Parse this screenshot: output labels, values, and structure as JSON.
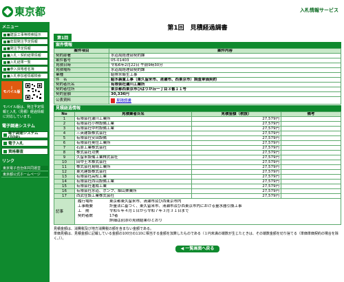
{
  "header": {
    "logo": "東京都",
    "right_link": "入札情報サービス"
  },
  "sidebar": {
    "menu_title": "メニュー",
    "items": [
      "■建設工事等検索提示",
      "■年間発注予定情報",
      "■発注予定情報",
      "■入札・契約結果情報",
      "■入札結果一覧",
      "■参入資格者名簿",
      "■入札参加者情報検索"
    ],
    "mobile_label": "モバイル版",
    "mobile_note": "モバイル版は、発注予定情報と入札（見積）経過情報に対応しています。",
    "system_title": "電子調達システム",
    "buttons": [
      "電子調達システム(TOP)",
      "電子入札",
      "資格審査"
    ],
    "links_title": "リンク",
    "links": [
      "東京電子自治体共同運営",
      "東京都公式ホームページ"
    ]
  },
  "main": {
    "title": "第1回　見積経過調書",
    "round_tab": "第1回",
    "info_bar": "案件情報",
    "info_header": {
      "item": "案件項目",
      "content": "案件内容"
    },
    "info_rows": [
      {
        "k": "契約部署",
        "v": "水道局経理部契約課"
      },
      {
        "k": "案件番号",
        "v": "05-01403"
      },
      {
        "k": "見積日時",
        "v": "令和6年2月22日 午前9時30分"
      },
      {
        "k": "見積場所",
        "v": "水道局経理部契約課"
      },
      {
        "k": "業種",
        "v": "給排水衛生工事"
      },
      {
        "k": "件　名",
        "v": "給水装置工事（東久留米市、清瀬市、西東京市）調査単価契約"
      },
      {
        "k": "契約者氏名",
        "v": "有限会社瀬川工業所"
      },
      {
        "k": "契約者住所",
        "v": "東京都西東京市ひばりが丘一丁目３番１１号"
      },
      {
        "k": "契約金額",
        "v": "30,336円"
      },
      {
        "k": "公表資料",
        "v": "見積調書"
      }
    ],
    "result_bar": "見積経過情報",
    "result_header": {
      "no": "No",
      "name": "見積業者氏名",
      "amount": "見積金額（税抜）",
      "remark": "備考"
    },
    "results": [
      {
        "no": "1",
        "name": "有限会社瀬川工業所",
        "amount": "27,579円"
      },
      {
        "no": "2",
        "name": "有限会社小林設備工業",
        "amount": "27,579円"
      },
      {
        "no": "3",
        "name": "有限会社中村設備工業",
        "amount": "27,579円"
      },
      {
        "no": "4",
        "name": "三英建設株式会社",
        "amount": "27,579円"
      },
      {
        "no": "5",
        "name": "有限会社安田設備",
        "amount": "27,579円"
      },
      {
        "no": "6",
        "name": "有限会社奥住工業所",
        "amount": "27,579円"
      },
      {
        "no": "7",
        "name": "石原工業株式会社",
        "amount": "27,579円"
      },
      {
        "no": "8",
        "name": "株式会社功美",
        "amount": "27,579円"
      },
      {
        "no": "9",
        "name": "久留米設備工業株式会社",
        "amount": "27,579円"
      },
      {
        "no": "10",
        "name": "田中土木株式会社",
        "amount": "27,579円"
      },
      {
        "no": "11",
        "name": "株式会社島崎工業所",
        "amount": "27,579円"
      },
      {
        "no": "12",
        "name": "東光建設株式会社",
        "amount": "27,579円"
      },
      {
        "no": "13",
        "name": "有限会社高松工業",
        "amount": "27,579円"
      },
      {
        "no": "14",
        "name": "有限会社西山設備工業",
        "amount": "27,579円"
      },
      {
        "no": "15",
        "name": "有限会社進成工業",
        "amount": "27,579円"
      },
      {
        "no": "16",
        "name": "有限会社水道、ポンプ、細山栗業所",
        "amount": "27,579円"
      },
      {
        "no": "17",
        "name": "西武住設工業株式会社",
        "amount": "27,579円"
      }
    ],
    "remarks_label": "記事",
    "remarks": [
      {
        "k": "履行場所",
        "v": "東京都東久留米市、清瀬市及び西東京市内"
      },
      {
        "k": "工事概要",
        "v": "計量法に基づく、東久留米市、清瀬市及び西東京市内における量水器引換工事"
      },
      {
        "k": "工　期",
        "v": "令和６年４月１日から令和７年３月３１日まで"
      },
      {
        "k": "契約者数",
        "v": "17者"
      },
      {
        "k": "",
        "v": "詳細は別添の見積結果のとおり"
      }
    ],
    "note1": "見積金額は、消費税及び地方消費税の額を含まない金額である。",
    "note2": "単価見積は、見積金額に記載している金額の100分の110に相当する金額を加算したものである（１円未満の端数が生じたときは、その端数金額を切り捨てる（単価単価契約の場合を除く。））。",
    "back_button": "◀ 一覧画面へ戻る"
  }
}
